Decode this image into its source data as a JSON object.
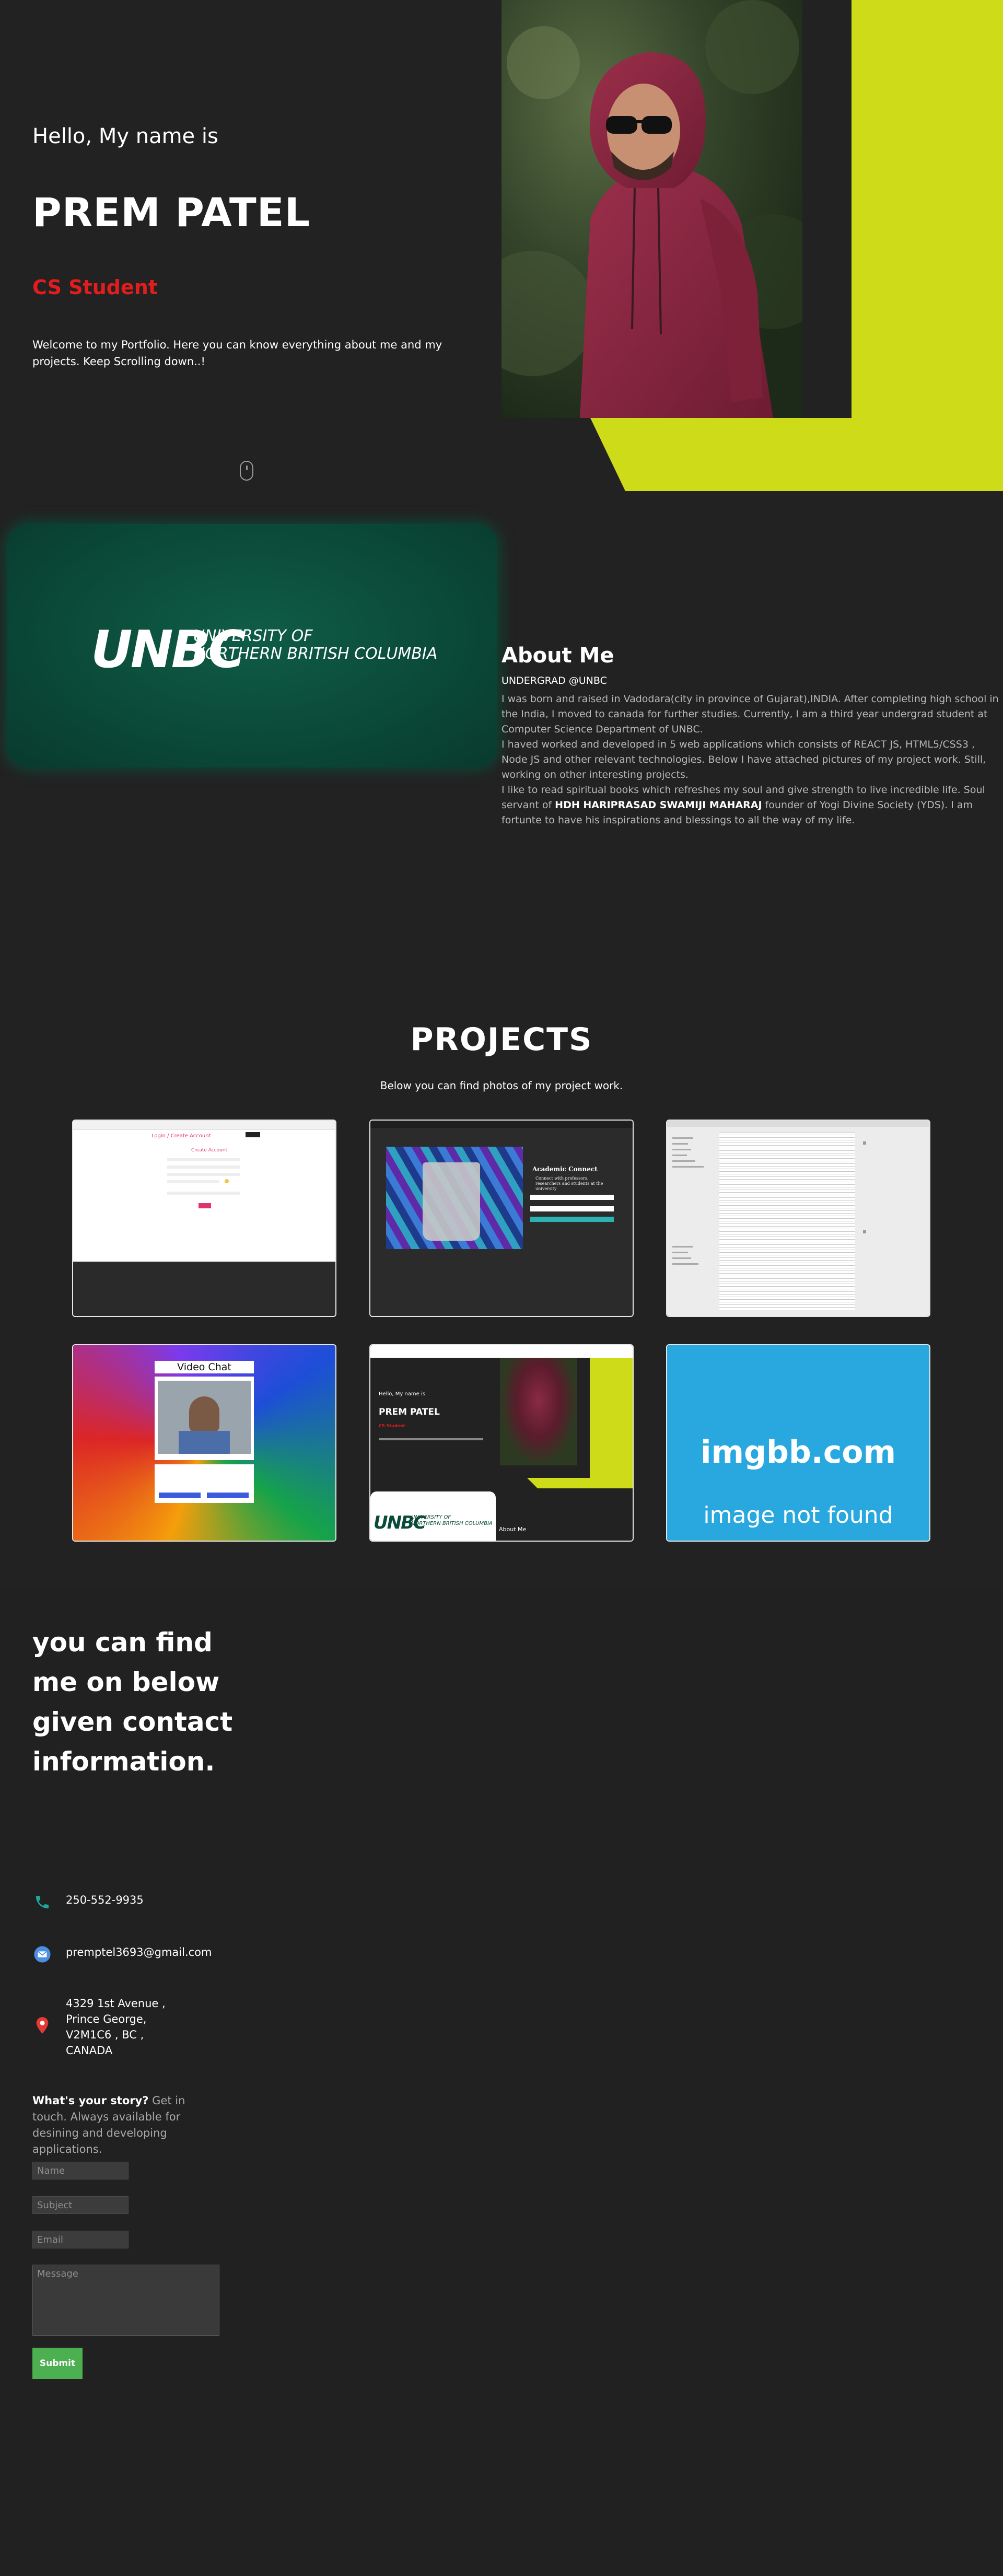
{
  "hero": {
    "greeting": "Hello, My name is",
    "name": "PREM PATEL",
    "role": "CS Student",
    "welcome": "Welcome to my Portfolio. Here you can know everything about me and my projects. Keep Scrolling down..!"
  },
  "theme_toggle": {
    "icon": "moon-icon"
  },
  "about": {
    "logo_mark": "UNBC",
    "logo_line1": "UNIVERSITY OF",
    "logo_line2": "NORTHERN BRITISH COLUMBIA",
    "title": "About Me",
    "subtitle": "UNDERGRAD @UNBC",
    "para1": "I was born and raised in Vadodara(city in province of Gujarat),INDIA. After completing high school in the India, I moved to canada for further studies. Currently, I am a third year undergrad student at Computer Science Department of UNBC.",
    "para2": "I haved worked and developed in 5 web applications which consists of REACT JS, HTML5/CSS3 , Node JS and other relevant technologies. Below I have attached pictures of my project work. Still, working on other interesting projects.",
    "para3_pre": "I like to read spiritual books which refreshes my soul and give strength to live incredible life. Soul servant of ",
    "para3_bold": "HDH HARIPRASAD SWAMIJI MAHARAJ",
    "para3_post": " founder of Yogi Divine Society (YDS). I am fortunte to have his inspirations and blessings to all the way of my life."
  },
  "projects": {
    "title": "PROJECTS",
    "subtitle": "Below you can find photos of my project work.",
    "p1": {
      "header": "Login / Create Account",
      "form_title": "Create Account"
    },
    "p2": {
      "title": "Academic Connect",
      "tagline": "Connect with professors, researchers and students at the university"
    },
    "p4": {
      "title": "Video Chat"
    },
    "p5": {
      "greeting": "Hello, My name is",
      "name": "PREM PATEL",
      "role": "CS Student",
      "logo": "UNBC",
      "logo_line1": "UNIVERSITY OF",
      "logo_line2": "NORTHERN BRITISH COLUMBIA",
      "about": "About Me"
    },
    "p6": {
      "line1": "imgbb.com",
      "line2": "image not found"
    }
  },
  "contact": {
    "heading": "you can find me on below given contact information.",
    "phone": "250-552-9935",
    "email": "premptel3693@gmail.com",
    "address_line1": "4329 1st Avenue ,",
    "address_line2": "Prince George,",
    "address_line3": "V2M1C6 , BC ,",
    "address_line4": "CANADA",
    "story_bold": "What's your story?",
    "story_rest": " Get in touch. Always available for desining and developing applications.",
    "name_placeholder": "Name",
    "subject_placeholder": "Subject",
    "email_placeholder": "Email",
    "message_placeholder": "Message",
    "submit_label": "Submit"
  },
  "colors": {
    "background": "#222222",
    "accent_lime": "#cddb19",
    "role_red": "#e21d1d",
    "unbc_green": "#0b4a39",
    "submit_green": "#4caf50",
    "imgbb_blue": "#29a8e0"
  }
}
